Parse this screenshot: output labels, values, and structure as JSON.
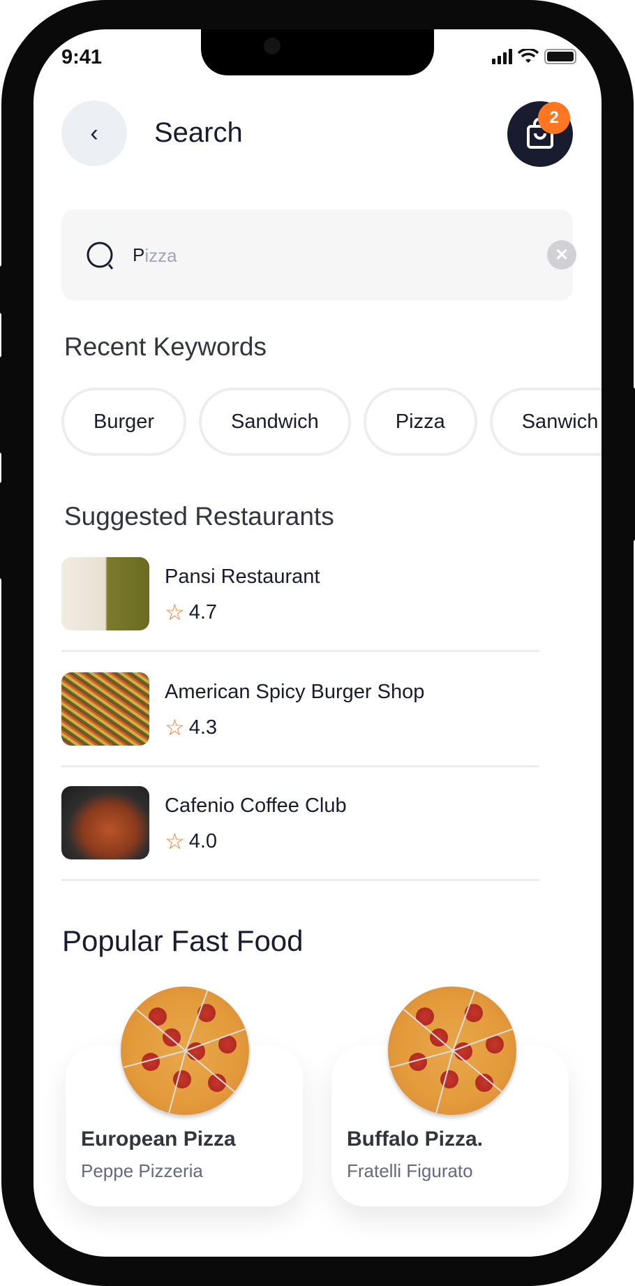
{
  "status_bar": {
    "time": "9:41"
  },
  "header": {
    "title": "Search",
    "back_icon": "chevron-left-icon",
    "cart_icon": "shopping-bag-icon",
    "cart_count": "2"
  },
  "search": {
    "value": "P",
    "placeholder": "Pizza"
  },
  "recent": {
    "heading": "Recent Keywords",
    "keywords": [
      "Burger",
      "Sandwich",
      "Pizza",
      "Sanwich"
    ]
  },
  "suggested": {
    "heading": "Suggested Restaurants",
    "restaurants": [
      {
        "name": "Pansi Restaurant",
        "rating": "4.7"
      },
      {
        "name": "American Spicy Burger Shop",
        "rating": "4.3"
      },
      {
        "name": "Cafenio Coffee Club",
        "rating": "4.0"
      }
    ]
  },
  "popular": {
    "heading": "Popular Fast Food",
    "items": [
      {
        "title": "European Pizza",
        "subtitle": "Peppe Pizzeria"
      },
      {
        "title": "Buffalo Pizza.",
        "subtitle": "Fratelli Figurato"
      }
    ]
  },
  "colors": {
    "accent": "#ff7622",
    "dark": "#181c2e",
    "chip_border": "#ededed",
    "search_bg": "#f6f6f6"
  }
}
